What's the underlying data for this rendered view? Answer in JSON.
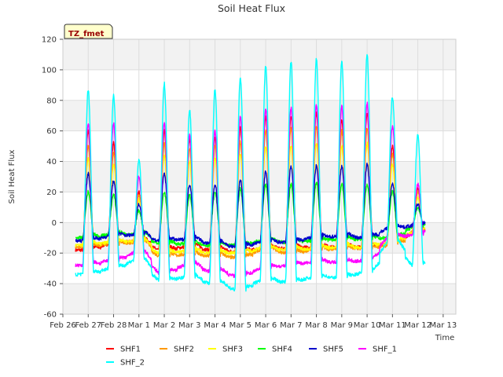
{
  "chart_data": {
    "type": "line",
    "title": "Soil Heat Flux",
    "xlabel": "Time",
    "ylabel": "Soil Heat Flux",
    "site_label": "TZ_fmet",
    "ylim": [
      -60,
      120
    ],
    "yticks": [
      -60,
      -40,
      -20,
      0,
      20,
      40,
      60,
      80,
      100,
      120
    ],
    "xlim": [
      0,
      15.5
    ],
    "xticks": [
      {
        "pos": 0,
        "label": "Feb 26"
      },
      {
        "pos": 1,
        "label": "Feb 27"
      },
      {
        "pos": 2,
        "label": "Feb 28"
      },
      {
        "pos": 3,
        "label": "Mar 1"
      },
      {
        "pos": 4,
        "label": "Mar 2"
      },
      {
        "pos": 5,
        "label": "Mar 3"
      },
      {
        "pos": 6,
        "label": "Mar 4"
      },
      {
        "pos": 7,
        "label": "Mar 5"
      },
      {
        "pos": 8,
        "label": "Mar 6"
      },
      {
        "pos": 9,
        "label": "Mar 7"
      },
      {
        "pos": 10,
        "label": "Mar 8"
      },
      {
        "pos": 11,
        "label": "Mar 9"
      },
      {
        "pos": 12,
        "label": "Mar 10"
      },
      {
        "pos": 13,
        "label": "Mar 11"
      },
      {
        "pos": 14,
        "label": "Mar 12"
      },
      {
        "pos": 15,
        "label": "Mar 13"
      }
    ],
    "grid": true,
    "legend_placement": "bottom",
    "x_start": 0.5,
    "x_end": 14.3,
    "peak_days": [
      1.0,
      2.0,
      3.0,
      4.0,
      5.0,
      6.0,
      7.0,
      8.0,
      9.0,
      10.0,
      11.0,
      12.0,
      13.0,
      14.0
    ],
    "series": [
      {
        "name": "SHF1",
        "color": "#ff0000",
        "peaks": [
          60,
          52,
          20,
          60,
          55,
          55,
          62,
          70,
          70,
          72,
          68,
          72,
          50,
          22
        ],
        "troughs": [
          -18,
          -14,
          -12,
          -18,
          -16,
          -18,
          -19,
          -17,
          -17,
          -16,
          -16,
          -16,
          -14,
          -7
        ]
      },
      {
        "name": "SHF2",
        "color": "#ff9900",
        "peaks": [
          50,
          45,
          18,
          52,
          48,
          50,
          53,
          60,
          62,
          63,
          60,
          62,
          45,
          20
        ],
        "troughs": [
          -16,
          -14,
          -13,
          -22,
          -21,
          -22,
          -23,
          -18,
          -20,
          -18,
          -17,
          -17,
          -15,
          -6
        ]
      },
      {
        "name": "SHF3",
        "color": "#ffff00",
        "peaks": [
          42,
          38,
          15,
          44,
          40,
          42,
          45,
          50,
          50,
          52,
          50,
          52,
          38,
          16
        ],
        "troughs": [
          -15,
          -13,
          -12,
          -20,
          -19,
          -20,
          -20,
          -17,
          -18,
          -17,
          -16,
          -16,
          -13,
          -6
        ]
      },
      {
        "name": "SHF4",
        "color": "#00ff00",
        "peaks": [
          20,
          18,
          8,
          20,
          18,
          20,
          22,
          25,
          25,
          26,
          25,
          25,
          20,
          10
        ],
        "troughs": [
          -10,
          -8,
          -8,
          -14,
          -14,
          -15,
          -15,
          -12,
          -13,
          -12,
          -11,
          -11,
          -10,
          -3
        ]
      },
      {
        "name": "SHF5",
        "color": "#0000cc",
        "peaks": [
          32,
          27,
          12,
          32,
          25,
          25,
          28,
          33,
          37,
          37,
          37,
          38,
          25,
          12
        ],
        "troughs": [
          -12,
          -9,
          -8,
          -12,
          -11,
          -14,
          -16,
          -13,
          -13,
          -10,
          -9,
          -10,
          -4,
          -2
        ]
      },
      {
        "name": "SHF_1",
        "color": "#ff00ff",
        "peaks": [
          65,
          65,
          30,
          66,
          57,
          60,
          70,
          75,
          75,
          77,
          76,
          78,
          63,
          25
        ],
        "troughs": [
          -28,
          -25,
          -20,
          -33,
          -28,
          -32,
          -35,
          -30,
          -28,
          -26,
          -26,
          -25,
          -10,
          -8
        ]
      },
      {
        "name": "SHF_2",
        "color": "#00ffff",
        "peaks": [
          87,
          83,
          41,
          91,
          73,
          87,
          95,
          102,
          105,
          107,
          106,
          110,
          82,
          58
        ],
        "troughs": [
          -34,
          -30,
          -25,
          -38,
          -36,
          -40,
          -44,
          -38,
          -39,
          -36,
          -36,
          -33,
          -13,
          -28
        ]
      }
    ]
  }
}
